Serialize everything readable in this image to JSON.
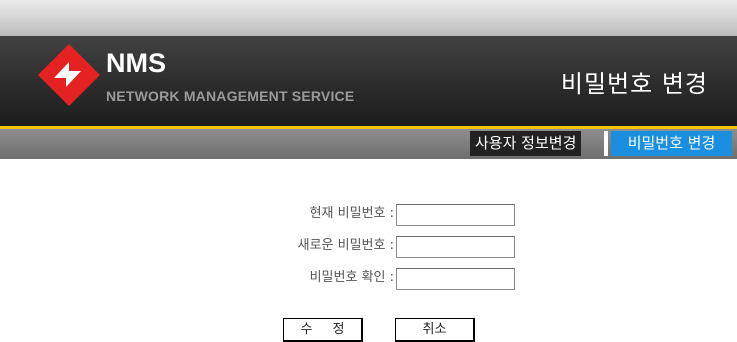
{
  "header": {
    "logo_title": "NMS",
    "logo_subtitle": "NETWORK MANAGEMENT SERVICE",
    "page_heading": "비밀번호 변경",
    "logo_icon": "nms-diamond-logo-icon",
    "brand_color": "#e52222",
    "accent_color": "#f2c400"
  },
  "nav": {
    "items": [
      {
        "label": "사용자 정보변경",
        "active": false
      },
      {
        "label": "비밀번호 변경",
        "active": true
      }
    ],
    "active_color": "#1a8fe0"
  },
  "form": {
    "current_password_label": "현재 비밀번호 :",
    "current_password_value": "",
    "new_password_label": "새로운 비밀번호 :",
    "new_password_value": "",
    "confirm_password_label": "비밀번호 확인 :",
    "confirm_password_value": ""
  },
  "buttons": {
    "submit_label": "수 정",
    "cancel_label": "취소"
  }
}
